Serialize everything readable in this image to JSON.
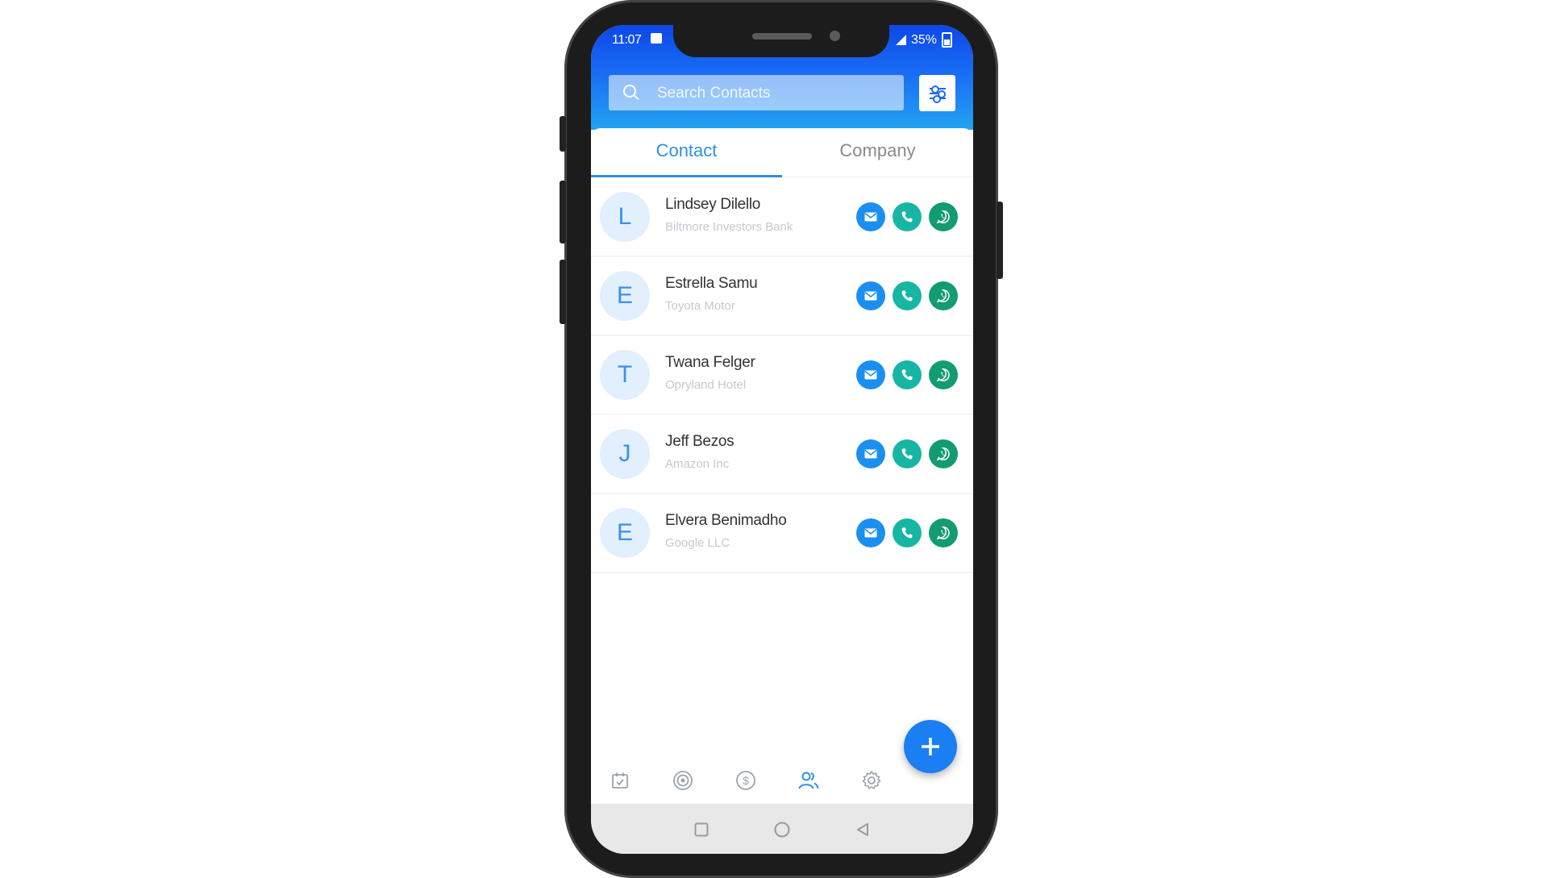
{
  "status_bar": {
    "time": "11:07",
    "battery": "35%"
  },
  "search": {
    "placeholder": "Search Contacts"
  },
  "tabs": [
    {
      "label": "Contact",
      "active": true
    },
    {
      "label": "Company",
      "active": false
    }
  ],
  "contacts": [
    {
      "initial": "L",
      "name": "Lindsey Dilello",
      "company": "Biltmore Investors Bank"
    },
    {
      "initial": "E",
      "name": "Estrella Samu",
      "company": "Toyota Motor"
    },
    {
      "initial": "T",
      "name": "Twana Felger",
      "company": "Opryland Hotel"
    },
    {
      "initial": "J",
      "name": "Jeff Bezos",
      "company": "Amazon Inc"
    },
    {
      "initial": "E",
      "name": "Elvera Benimadho",
      "company": "Google LLC"
    }
  ],
  "row_actions": [
    "mail-icon",
    "phone-icon",
    "whatsapp-icon"
  ],
  "bottom_nav": [
    {
      "icon": "calendar-check-icon",
      "active": false
    },
    {
      "icon": "target-icon",
      "active": false
    },
    {
      "icon": "dollar-icon",
      "active": false
    },
    {
      "icon": "contacts-icon",
      "active": true
    },
    {
      "icon": "gear-icon",
      "active": false
    }
  ],
  "fab_icon": "plus-icon",
  "system_nav": [
    "recent-apps-icon",
    "home-icon",
    "back-icon"
  ],
  "colors": {
    "header_gradient": [
      "#0d47e6",
      "#22a3f2"
    ],
    "accent": "#2d8fe6",
    "mail": "#1b8ff0",
    "call": "#17b6a4",
    "whatsapp": "#139b72"
  }
}
